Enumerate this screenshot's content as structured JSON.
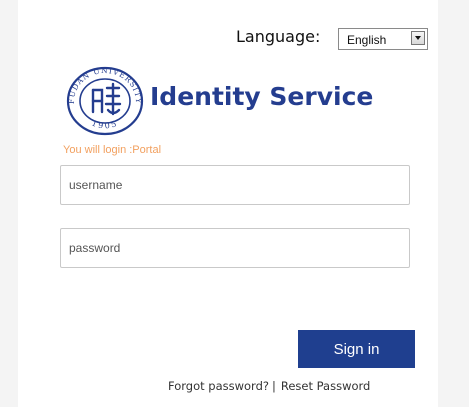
{
  "language": {
    "label": "Language:",
    "selected": "English",
    "arrow_icon": "chevron-down-icon"
  },
  "header": {
    "seal_top_text": "FUDAN UNIVERSITY",
    "seal_year": "1905",
    "title": "Identity Service",
    "title_color": "#243d8f"
  },
  "notice": {
    "text": "You will login :Portal",
    "color": "#f2a05f"
  },
  "form": {
    "username_placeholder": "username",
    "password_placeholder": "password",
    "signin_label": "Sign in",
    "signin_color": "#1f3f8f"
  },
  "links": {
    "forgot": "Forgot password?",
    "separator": "|",
    "reset": "Reset Password"
  }
}
